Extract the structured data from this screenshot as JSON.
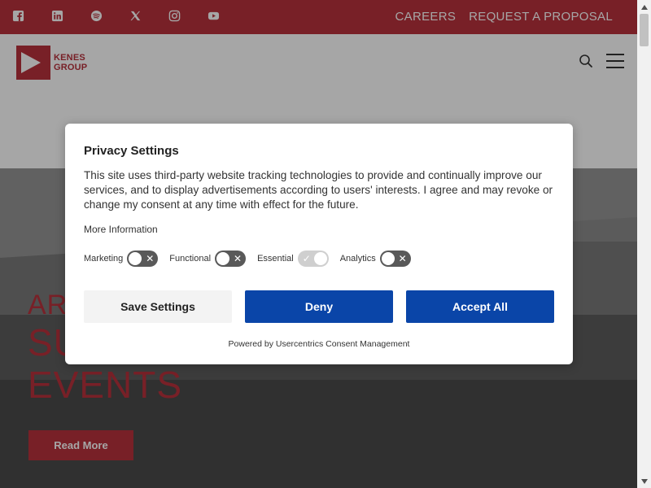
{
  "top_links": [
    "CAREERS",
    "REQUEST A PROPOSAL"
  ],
  "social_icons": [
    "facebook-icon",
    "linkedin-icon",
    "spotify-icon",
    "x-icon",
    "instagram-icon",
    "youtube-icon"
  ],
  "logo": {
    "line1": "KENES",
    "line2": "GROUP"
  },
  "hero": {
    "line1": "ARO",
    "line2": "SU",
    "line3": "EVENTS",
    "read_more": "Read More"
  },
  "dialog": {
    "title": "Privacy Settings",
    "description": "This site uses third-party website tracking technologies to provide and continually improve our services, and to display advertisements according to users' interests. I agree and may revoke or change my consent at any time with effect for the future.",
    "more_info": "More Information",
    "toggles": [
      {
        "label": "Marketing",
        "state": "off"
      },
      {
        "label": "Functional",
        "state": "off"
      },
      {
        "label": "Essential",
        "state": "on-disabled"
      },
      {
        "label": "Analytics",
        "state": "off"
      }
    ],
    "buttons": {
      "save": "Save Settings",
      "deny": "Deny",
      "accept": "Accept All"
    },
    "powered_by": "Powered by Usercentrics Consent Management"
  },
  "colors": {
    "brand_red": "#b8323d",
    "button_blue": "#0a45a8"
  }
}
